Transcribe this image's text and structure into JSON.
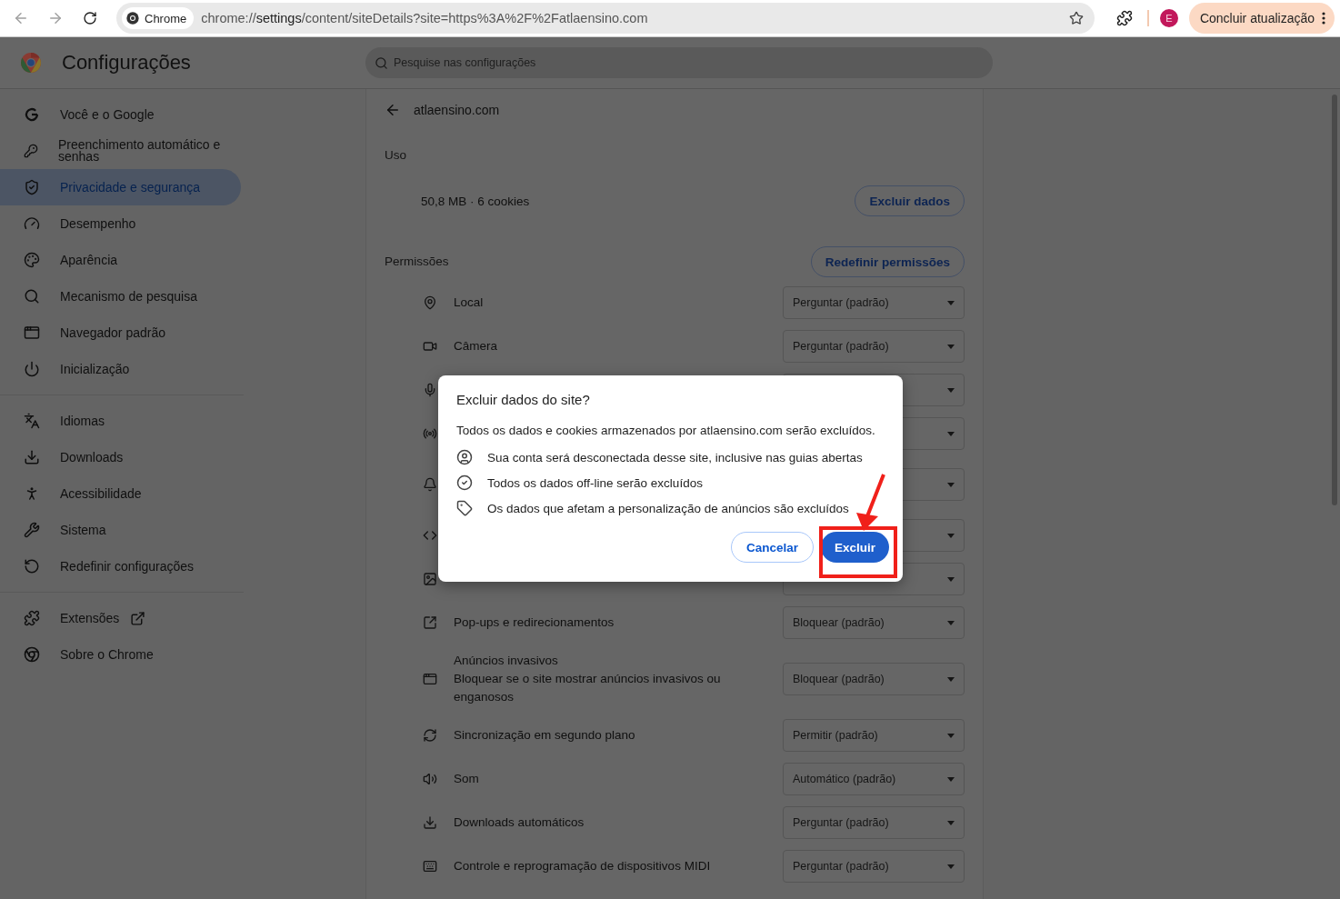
{
  "browser": {
    "chip": "Chrome",
    "url": "chrome://**settings**/content/siteDetails?site=https%3A%2F%2Fatlaensino.com",
    "profile_initial": "E",
    "update_button": "Concluir atualização"
  },
  "header": {
    "title": "Configurações",
    "search_placeholder": "Pesquise nas configurações"
  },
  "sidebar": {
    "groups": [
      {
        "items": [
          {
            "label": "Você e o Google",
            "selected": false
          },
          {
            "label": "Preenchimento automático e senhas",
            "selected": false
          },
          {
            "label": "Privacidade e segurança",
            "selected": true
          },
          {
            "label": "Desempenho",
            "selected": false
          },
          {
            "label": "Aparência",
            "selected": false
          },
          {
            "label": "Mecanismo de pesquisa",
            "selected": false
          },
          {
            "label": "Navegador padrão",
            "selected": false
          },
          {
            "label": "Inicialização",
            "selected": false
          }
        ]
      },
      {
        "items": [
          {
            "label": "Idiomas",
            "selected": false
          },
          {
            "label": "Downloads",
            "selected": false
          },
          {
            "label": "Acessibilidade",
            "selected": false
          },
          {
            "label": "Sistema",
            "selected": false
          },
          {
            "label": "Redefinir configurações",
            "selected": false
          }
        ]
      },
      {
        "items": [
          {
            "label": "Extensões",
            "selected": false,
            "external": true
          },
          {
            "label": "Sobre o Chrome",
            "selected": false
          }
        ]
      }
    ]
  },
  "site": {
    "name": "atlaensino.com"
  },
  "usage": {
    "heading": "Uso",
    "summary": "50,8 MB · 6 cookies",
    "button": "Excluir dados"
  },
  "permissions": {
    "heading": "Permissões",
    "reset_button": "Redefinir permissões",
    "rows": [
      {
        "label": "Local",
        "value": "Perguntar (padrão)"
      },
      {
        "label": "Câmera",
        "value": "Perguntar (padrão)"
      },
      {},
      {},
      {},
      {},
      {},
      {
        "label": "Pop-ups e redirecionamentos",
        "value": "Bloquear (padrão)"
      },
      {
        "label": "Anúncios invasivos",
        "description": "Bloquear se o site mostrar anúncios invasivos ou enganosos",
        "value": "Bloquear (padrão)"
      },
      {
        "label": "Sincronização em segundo plano",
        "value": "Permitir (padrão)"
      },
      {
        "label": "Som",
        "value": "Automático (padrão)"
      },
      {
        "label": "Downloads automáticos",
        "value": "Perguntar (padrão)"
      },
      {
        "label": "Controle e reprogramação de dispositivos MIDI",
        "value": "Perguntar (padrão)"
      }
    ]
  },
  "dialog": {
    "title": "Excluir dados do site?",
    "message": "Todos os dados e cookies armazenados por atlaensino.com serão excluídos.",
    "items": [
      {
        "text": "Sua conta será desconectada desse site, inclusive nas guias abertas"
      },
      {
        "text": "Todos os dados off-line serão excluídos"
      },
      {
        "text": "Os dados que afetam a personalização de anúncios são excluídos"
      }
    ],
    "cancel_button": "Cancelar",
    "confirm_button": "Excluir"
  },
  "annotation": {
    "arrow": true,
    "highlight_frame": true
  }
}
